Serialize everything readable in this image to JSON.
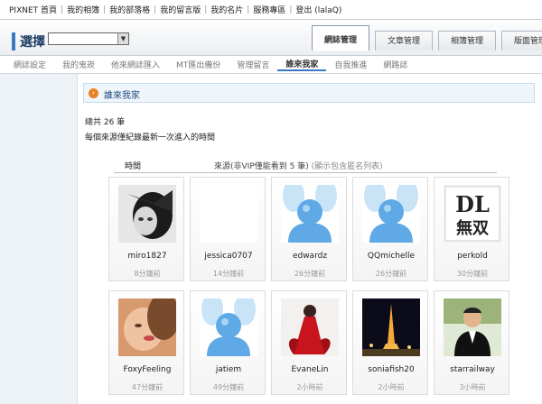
{
  "topbar": {
    "links": [
      "PIXNET 首頁",
      "我的相簿",
      "我的部落格",
      "我的留言版",
      "我的名片",
      "服務專區",
      "登出 (lalaQ)"
    ]
  },
  "header": {
    "select_label": "選擇",
    "select_value": "",
    "tabs": [
      {
        "label": "網誌管理",
        "active": true
      },
      {
        "label": "文章管理",
        "active": false
      },
      {
        "label": "相簿管理",
        "active": false
      },
      {
        "label": "版面管理",
        "active": false
      }
    ]
  },
  "subnav": {
    "items": [
      {
        "label": "網誌設定",
        "active": false
      },
      {
        "label": "我的鬼崁",
        "active": false
      },
      {
        "label": "他來網誌匯入",
        "active": false
      },
      {
        "label": "MT匯出備份",
        "active": false
      },
      {
        "label": "管理留言",
        "active": false
      },
      {
        "label": "誰來我家",
        "active": true
      },
      {
        "label": "自我推進",
        "active": false
      },
      {
        "label": "網路誌",
        "active": false
      }
    ]
  },
  "main": {
    "title": "誰來我家",
    "total": "總共 26 筆",
    "note": "每個來源僅紀錄最新一次進入的時間",
    "col_time": "時間",
    "col_source": "來源(非VIP僅能看到 5 筆)",
    "col_source_note": "(顯示包含匿名列表)"
  },
  "colors": {
    "accent": "#3a78c2",
    "title_icon": "#e8821e",
    "sidebar_bg": "#edf2f7"
  },
  "visitors": [
    {
      "name": "miro1827",
      "time": "8分鐘前",
      "avatar": "bw-portrait"
    },
    {
      "name": "jessica0707",
      "time": "14分鐘前",
      "avatar": "blank"
    },
    {
      "name": "edwardz",
      "time": "26分鐘前",
      "avatar": "default-avatar"
    },
    {
      "name": "QQmichelle",
      "time": "26分鐘前",
      "avatar": "default-avatar"
    },
    {
      "name": "perkold",
      "time": "30分鐘前",
      "avatar": "dl-logo"
    },
    {
      "name": "FoxyFeeling",
      "time": "47分鐘前",
      "avatar": "blurred-face"
    },
    {
      "name": "jatiem",
      "time": "49分鐘前",
      "avatar": "default-avatar"
    },
    {
      "name": "EvaneLin",
      "time": "2小時前",
      "avatar": "red-dress"
    },
    {
      "name": "soniafish20",
      "time": "2小時前",
      "avatar": "eiffel-night"
    },
    {
      "name": "starrailway",
      "time": "3小時前",
      "avatar": "graduate"
    }
  ],
  "dl_logo_text": {
    "top": "DL",
    "bottom": "無双"
  }
}
